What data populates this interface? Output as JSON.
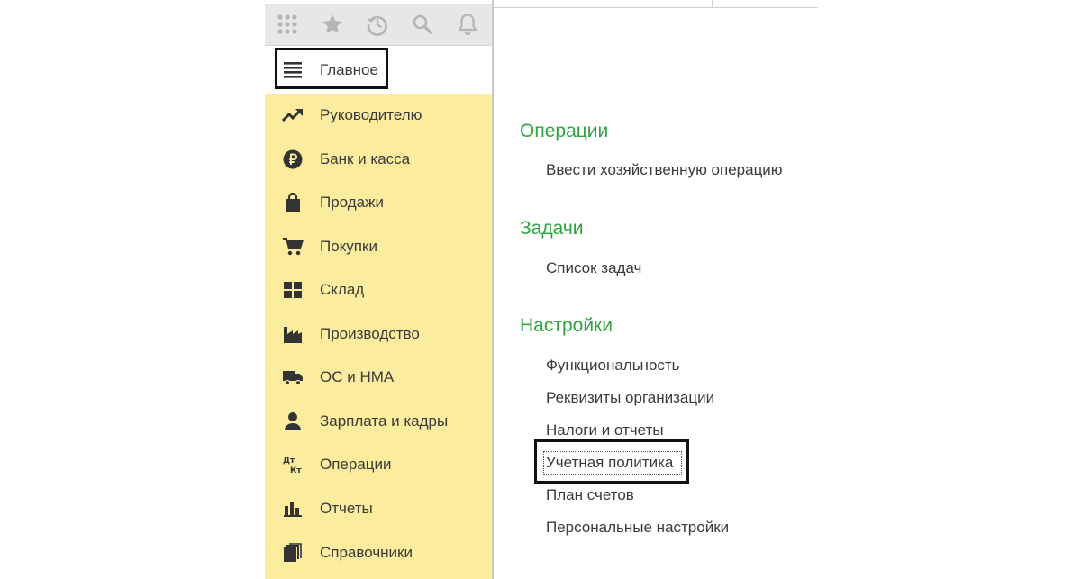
{
  "toolbar": {
    "buttons": [
      {
        "icon": "apps-grid-icon"
      },
      {
        "icon": "star-icon"
      },
      {
        "icon": "history-icon"
      },
      {
        "icon": "search-icon"
      },
      {
        "icon": "bell-icon"
      }
    ]
  },
  "sidebar": {
    "main": {
      "label": "Главное",
      "icon": "menu-icon"
    },
    "items": [
      {
        "label": "Руководителю",
        "icon": "trend-icon"
      },
      {
        "label": "Банк и касса",
        "icon": "ruble-icon"
      },
      {
        "label": "Продажи",
        "icon": "shopping-bag-icon"
      },
      {
        "label": "Покупки",
        "icon": "cart-icon"
      },
      {
        "label": "Склад",
        "icon": "warehouse-icon"
      },
      {
        "label": "Производство",
        "icon": "factory-icon"
      },
      {
        "label": "ОС и НМА",
        "icon": "truck-icon"
      },
      {
        "label": "Зарплата и кадры",
        "icon": "person-icon"
      },
      {
        "label": "Операции",
        "icon": "debit-credit-icon"
      },
      {
        "label": "Отчеты",
        "icon": "bar-chart-icon"
      },
      {
        "label": "Справочники",
        "icon": "books-icon"
      }
    ]
  },
  "content": {
    "sections": [
      {
        "title": "Операции",
        "links": [
          "Ввести хозяйственную операцию"
        ]
      },
      {
        "title": "Задачи",
        "links": [
          "Список задач"
        ]
      },
      {
        "title": "Настройки",
        "links": [
          "Функциональность",
          "Реквизиты организации",
          "Налоги и отчеты",
          "Учетная политика",
          "План счетов",
          "Персональные настройки"
        ]
      }
    ]
  },
  "colors": {
    "sidebar_bg": "#fbec9e",
    "section_title": "#2ca53f",
    "toolbar_bg": "#e7e7e7"
  }
}
